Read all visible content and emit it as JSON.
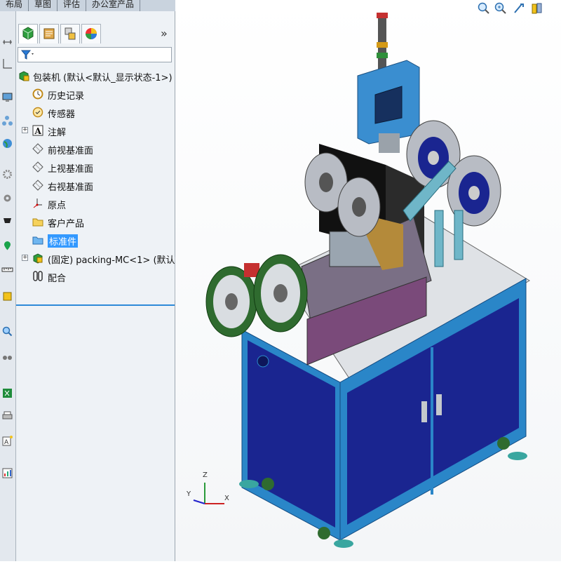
{
  "top_tabs": [
    "布局",
    "草图",
    "评估",
    "办公室产品"
  ],
  "panel": {
    "more_label": "»",
    "tabs": [
      "feature-manager-icon",
      "property-manager-icon",
      "configuration-manager-icon",
      "display-manager-icon"
    ],
    "filter_icon": "filter-icon",
    "tree": {
      "root_label": "包装机  (默认<默认_显示状态-1>)",
      "items": [
        {
          "label": "历史记录",
          "icon": "history-icon"
        },
        {
          "label": "传感器",
          "icon": "sensor-icon"
        },
        {
          "label": "注解",
          "icon": "annotation-icon"
        },
        {
          "label": "前视基准面",
          "icon": "plane-icon"
        },
        {
          "label": "上视基准面",
          "icon": "plane-icon"
        },
        {
          "label": "右视基准面",
          "icon": "plane-icon"
        },
        {
          "label": "原点",
          "icon": "origin-icon"
        },
        {
          "label": "客户产品",
          "icon": "folder-icon"
        },
        {
          "label": "标准件",
          "icon": "folder-icon"
        },
        {
          "label": "(固定) packing-MC<1> (默认",
          "icon": "assembly-icon"
        },
        {
          "label": "配合",
          "icon": "mates-icon"
        }
      ]
    }
  },
  "viewport": {
    "axis_labels": {
      "x": "X",
      "y": "Y",
      "z": "Z"
    },
    "tools": [
      "zoom-to-fit-icon",
      "zoom-area-icon",
      "previous-view-icon",
      "section-view-icon"
    ]
  },
  "colors": {
    "frame_blue": "#2a86c8",
    "panel_navy": "#1a2590",
    "reel_green": "#2f6b2f",
    "reel_grey": "#b8bcc4",
    "selection": "#3399ff"
  }
}
